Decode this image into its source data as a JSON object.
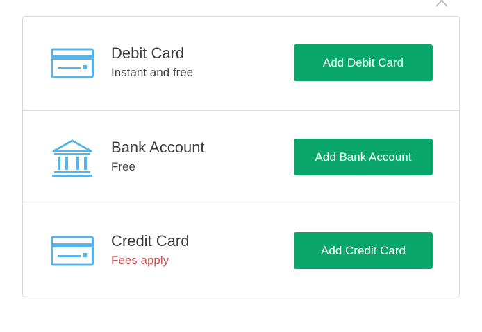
{
  "close_icon": "close-icon",
  "colors": {
    "accent": "#0aa66b",
    "icon": "#56b4e9",
    "warning": "#d24f4f"
  },
  "options": [
    {
      "icon": "card-icon",
      "title": "Debit Card",
      "subtitle": "Instant and free",
      "button": "Add Debit Card"
    },
    {
      "icon": "bank-icon",
      "title": "Bank Account",
      "subtitle": "Free",
      "button": "Add Bank Account"
    },
    {
      "icon": "card-icon",
      "title": "Credit Card",
      "subtitle": "Fees apply",
      "button": "Add Credit Card"
    }
  ]
}
